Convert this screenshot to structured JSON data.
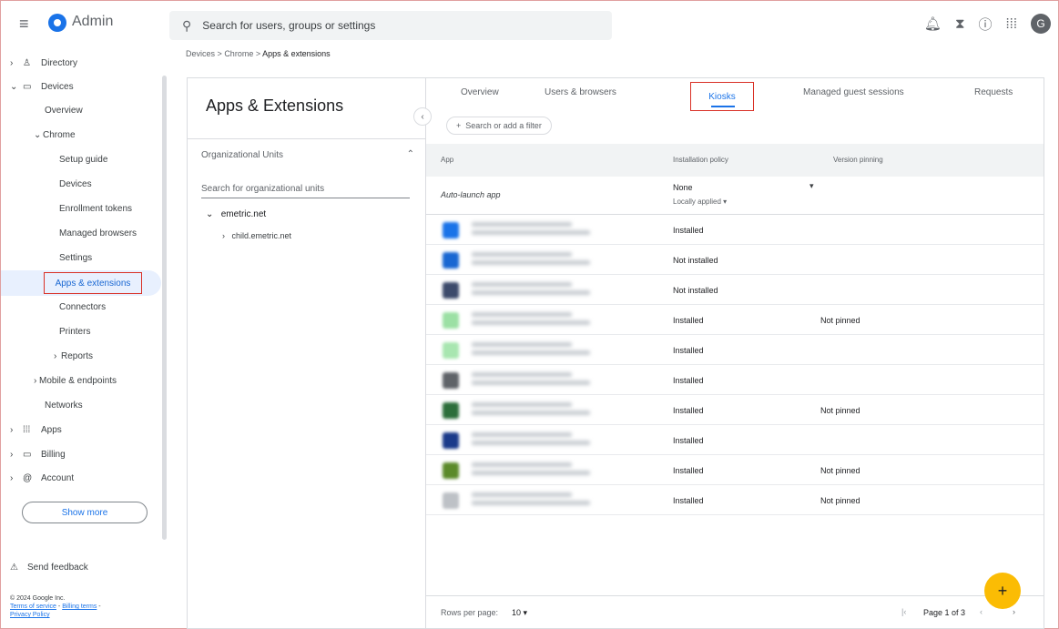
{
  "header": {
    "app_name": "Admin",
    "search_placeholder": "Search for users, groups or settings",
    "avatar_letter": "G",
    "icons": [
      "notifications-icon",
      "hourglass-icon",
      "help-icon",
      "apps-icon"
    ]
  },
  "breadcrumb": {
    "part1": "Devices",
    "part2": "Chrome",
    "current": "Apps & extensions",
    "sep": ">"
  },
  "sidebar": {
    "directory": "Directory",
    "devices": "Devices",
    "overview": "Overview",
    "chrome": "Chrome",
    "setup_guide": "Setup guide",
    "devices_sub": "Devices",
    "enrollment": "Enrollment tokens",
    "managed_browsers": "Managed browsers",
    "settings": "Settings",
    "apps_ext": "Apps & extensions",
    "connectors": "Connectors",
    "printers": "Printers",
    "reports": "Reports",
    "mobile": "Mobile & endpoints",
    "networks": "Networks",
    "apps": "Apps",
    "billing": "Billing",
    "account": "Account",
    "show_more": "Show more",
    "send_feedback": "Send feedback",
    "copyright": "© 2024 Google Inc.",
    "terms": "Terms of service",
    "billing_terms": "Billing terms",
    "privacy": "Privacy Policy"
  },
  "left_panel": {
    "title": "Apps & Extensions",
    "ou_header": "Organizational Units",
    "ou_search": "Search for organizational units",
    "root": "emetric.net",
    "child": "child.emetric.net"
  },
  "tabs": {
    "overview": "Overview",
    "users": "Users & browsers",
    "kiosks": "Kiosks",
    "guest": "Managed guest sessions",
    "requests": "Requests"
  },
  "filter_label": "Search or add a filter",
  "table": {
    "headers": {
      "app": "App",
      "policy": "Installation policy",
      "pinning": "Version pinning"
    },
    "auto_launch": {
      "label": "Auto-launch app",
      "value": "None",
      "sub": "Locally applied"
    },
    "rows": [
      {
        "policy": "Installed",
        "pin": ""
      },
      {
        "policy": "Not installed",
        "pin": ""
      },
      {
        "policy": "Not installed",
        "pin": ""
      },
      {
        "policy": "Installed",
        "pin": "Not pinned"
      },
      {
        "policy": "Installed",
        "pin": ""
      },
      {
        "policy": "Installed",
        "pin": ""
      },
      {
        "policy": "Installed",
        "pin": "Not pinned"
      },
      {
        "policy": "Installed",
        "pin": ""
      },
      {
        "policy": "Installed",
        "pin": "Not pinned"
      },
      {
        "policy": "Installed",
        "pin": "Not pinned"
      }
    ]
  },
  "footer": {
    "rows_label": "Rows per page:",
    "rows_value": "10",
    "page": "Page 1 of 3"
  },
  "fab": "+",
  "colors": {
    "accent": "#1a73e8",
    "highlight": "#d93025",
    "fab": "#fbbc04"
  }
}
